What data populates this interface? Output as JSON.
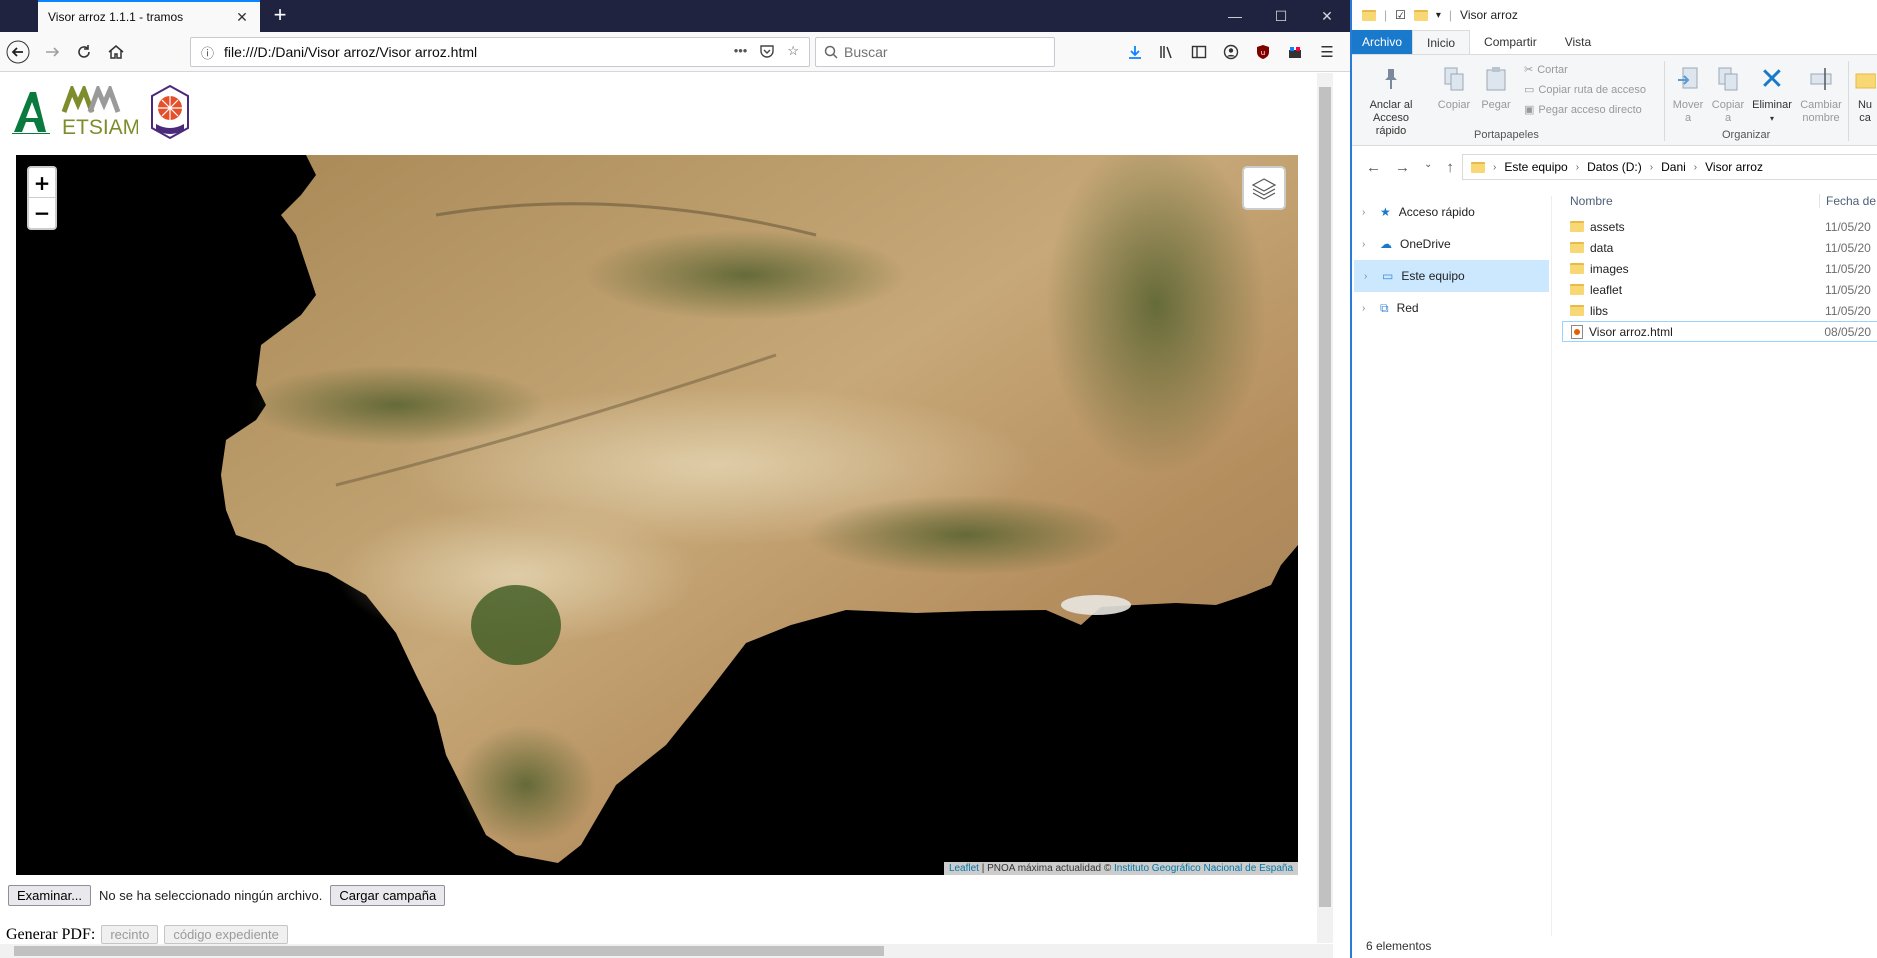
{
  "browser": {
    "tab_title": "Visor arroz 1.1.1 - tramos",
    "url": "file:///D:/Dani/Visor arroz/Visor arroz.html",
    "search_placeholder": "Buscar"
  },
  "page": {
    "logos": [
      "Junta de Andalucía",
      "ETSIAM",
      "Universidad de Córdoba"
    ],
    "logo_text": "ETSIAM",
    "map": {
      "zoom_in": "+",
      "zoom_out": "−",
      "attribution_leaflet": "Leaflet",
      "attribution_middle": " | PNOA máxima actualidad © ",
      "attribution_ign": "Instituto Geográfico Nacional de España"
    },
    "file_input": {
      "button": "Examinar...",
      "status": "No se ha seleccionado ningún archivo.",
      "load_button": "Cargar campaña"
    },
    "pdf": {
      "label": "Generar PDF:",
      "btn_recinto": "recinto",
      "btn_expediente": "código expediente"
    }
  },
  "explorer": {
    "title": "Visor arroz",
    "tabs": [
      "Archivo",
      "Inicio",
      "Compartir",
      "Vista"
    ],
    "ribbon": {
      "pin_line1": "Anclar al",
      "pin_line2": "Acceso rápido",
      "copy": "Copiar",
      "paste": "Pegar",
      "cut": "Cortar",
      "copy_path": "Copiar ruta de acceso",
      "paste_shortcut": "Pegar acceso directo",
      "group_clipboard": "Portapapeles",
      "move_line1": "Mover",
      "move_line2": "a",
      "copyto_line1": "Copiar",
      "copyto_line2": "a",
      "delete": "Eliminar",
      "rename_line1": "Cambiar",
      "rename_line2": "nombre",
      "group_organize": "Organizar",
      "new_line1": "Nu",
      "new_line2": "ca"
    },
    "breadcrumb": [
      "Este equipo",
      "Datos (D:)",
      "Dani",
      "Visor arroz"
    ],
    "tree": [
      {
        "label": "Acceso rápido"
      },
      {
        "label": "OneDrive"
      },
      {
        "label": "Este equipo"
      },
      {
        "label": "Red"
      }
    ],
    "columns": {
      "name": "Nombre",
      "date": "Fecha de"
    },
    "files": [
      {
        "name": "assets",
        "date": "11/05/20",
        "type": "folder"
      },
      {
        "name": "data",
        "date": "11/05/20",
        "type": "folder"
      },
      {
        "name": "images",
        "date": "11/05/20",
        "type": "folder"
      },
      {
        "name": "leaflet",
        "date": "11/05/20",
        "type": "folder"
      },
      {
        "name": "libs",
        "date": "11/05/20",
        "type": "folder"
      },
      {
        "name": "Visor arroz.html",
        "date": "08/05/20",
        "type": "html"
      }
    ],
    "status": "6 elementos"
  }
}
